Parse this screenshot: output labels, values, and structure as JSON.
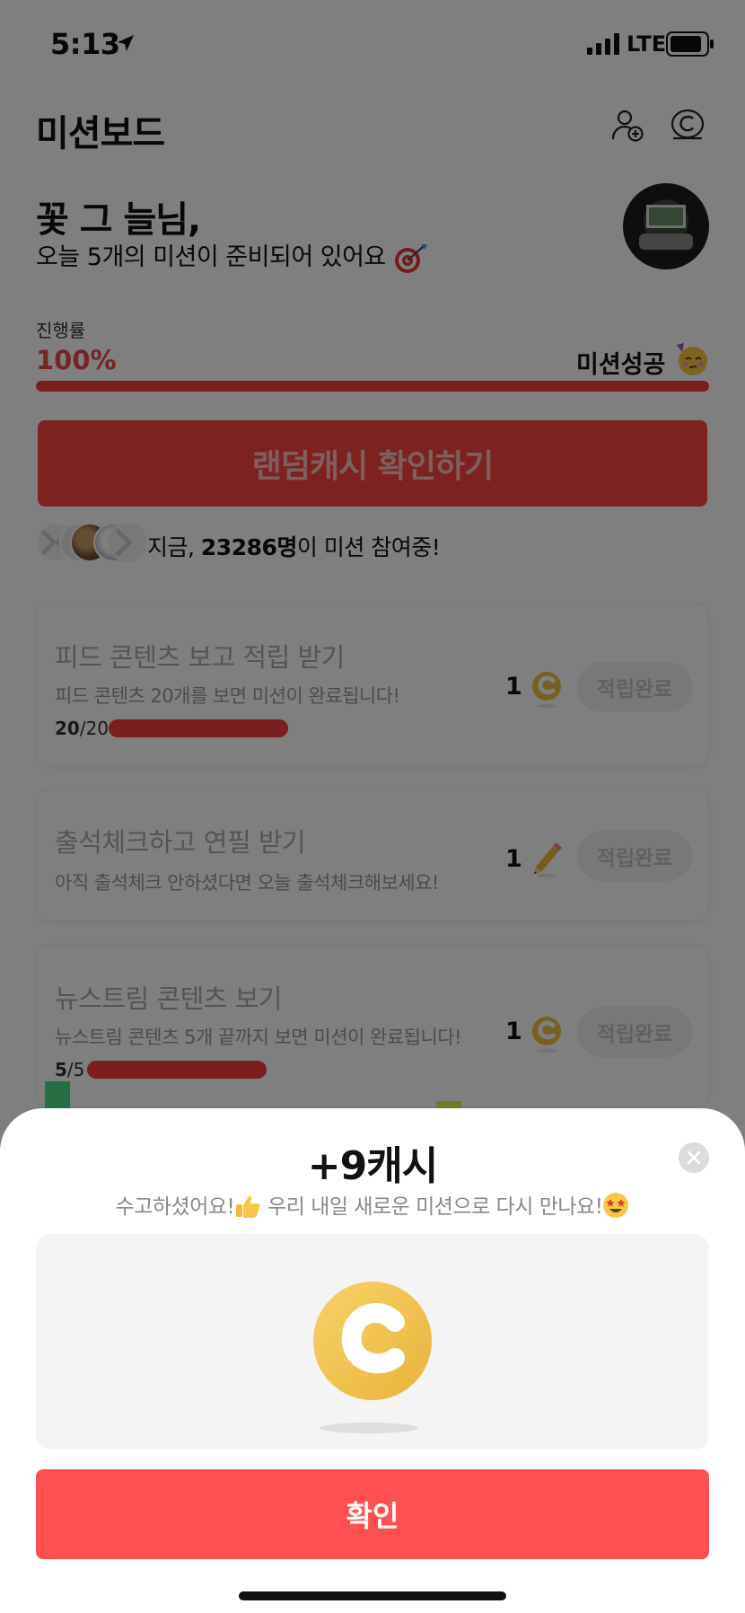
{
  "status_bar": {
    "time": "5:13",
    "network": "LTE"
  },
  "header": {
    "title": "미션보드"
  },
  "greeting": {
    "name": "꽃 그 늘님,",
    "message": "오늘 5개의 미션이 준비되어 있어요"
  },
  "progress": {
    "label": "진행률",
    "value_text": "100%",
    "value": 1.0,
    "status": "미션성공"
  },
  "random_cash_button": {
    "label": "랜덤캐시 확인하기"
  },
  "participants": {
    "prefix": "지금, ",
    "count": "23286명",
    "suffix": "이 미션 참여중!"
  },
  "missions": [
    {
      "title": "피드 콘텐츠 보고 적립 받기",
      "description": "피드 콘텐츠 20개를 보면 미션이 완료됩니다!",
      "count_done": "20",
      "count_total": "/20",
      "progress": 1.0,
      "reward": "1",
      "reward_icon": "coin-icon",
      "button": "적립완료"
    },
    {
      "title": "출석체크하고 연필 받기",
      "description": "아직 출석체크 안하셨다면 오늘 출석체크해보세요!",
      "reward": "1",
      "reward_icon": "pencil-icon",
      "button": "적립완료"
    },
    {
      "title": "뉴스트림 콘텐츠 보기",
      "description": "뉴스트림 콘텐츠 5개 끝까지 보면 미션이 완료됩니다!",
      "count_done": "5",
      "count_total": "/5",
      "progress": 1.0,
      "reward": "1",
      "reward_icon": "coin-icon",
      "button": "적립완료"
    }
  ],
  "sheet": {
    "title": "+9캐시",
    "message_part1": "수고하셨어요!",
    "message_part2": " 우리 내일 새로운 미션으로 다시 만나요!",
    "confirm_label": "확인"
  },
  "colors": {
    "accent": "#f23f3f",
    "button_red": "#fe5050",
    "coin_gold": "#f1c14b"
  }
}
